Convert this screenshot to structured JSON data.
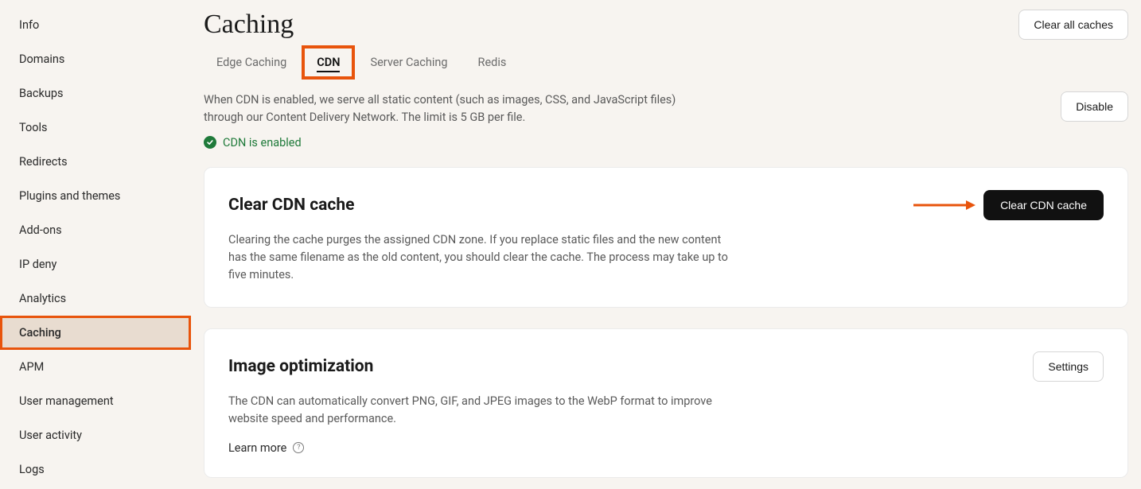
{
  "sidebar": {
    "items": [
      {
        "label": "Info"
      },
      {
        "label": "Domains"
      },
      {
        "label": "Backups"
      },
      {
        "label": "Tools"
      },
      {
        "label": "Redirects"
      },
      {
        "label": "Plugins and themes"
      },
      {
        "label": "Add-ons"
      },
      {
        "label": "IP deny"
      },
      {
        "label": "Analytics"
      },
      {
        "label": "Caching"
      },
      {
        "label": "APM"
      },
      {
        "label": "User management"
      },
      {
        "label": "User activity"
      },
      {
        "label": "Logs"
      }
    ],
    "active_index": 9
  },
  "header": {
    "title": "Caching",
    "clear_all_label": "Clear all caches"
  },
  "tabs": {
    "items": [
      {
        "label": "Edge Caching"
      },
      {
        "label": "CDN"
      },
      {
        "label": "Server Caching"
      },
      {
        "label": "Redis"
      }
    ],
    "active_index": 1
  },
  "cdn": {
    "description": "When CDN is enabled, we serve all static content (such as images, CSS, and JavaScript files) through our Content Delivery Network. The limit is 5 GB per file.",
    "disable_label": "Disable",
    "status_text": "CDN is enabled"
  },
  "clear_card": {
    "title": "Clear CDN cache",
    "description": "Clearing the cache purges the assigned CDN zone. If you replace static files and the new content has the same filename as the old content, you should clear the cache. The process may take up to five minutes.",
    "button_label": "Clear CDN cache"
  },
  "image_opt_card": {
    "title": "Image optimization",
    "description": "The CDN can automatically convert PNG, GIF, and JPEG images to the WebP format to improve website speed and performance.",
    "learn_more_label": "Learn more",
    "settings_label": "Settings"
  },
  "annotation": {
    "arrow_color": "#e8540c"
  }
}
